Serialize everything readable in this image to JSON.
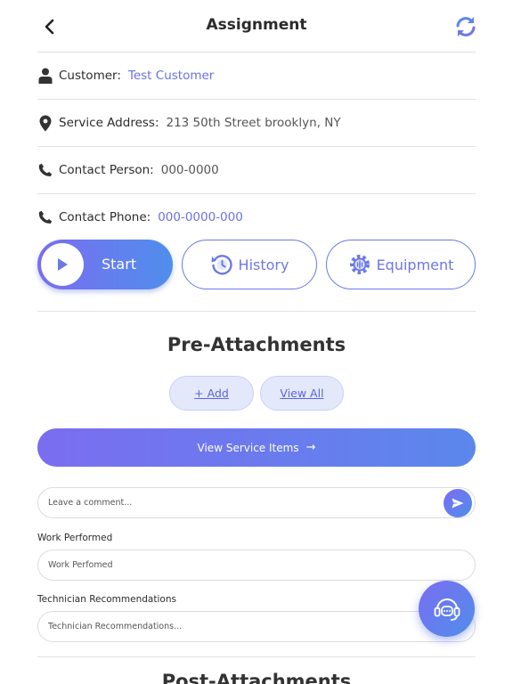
{
  "header": {
    "title": "Assignment",
    "back_icon": "chevron-left-icon",
    "refresh_icon": "refresh-icon"
  },
  "info": {
    "customer": {
      "label": "Customer:",
      "value": "Test Customer",
      "icon": "user-icon"
    },
    "address": {
      "label": "Service Address:",
      "value": "213 50th Street brooklyn, NY",
      "icon": "location-pin-icon"
    },
    "contact_person": {
      "label": "Contact Person:",
      "value": "000-0000",
      "icon": "phone-icon"
    },
    "contact_phone": {
      "label": "Contact Phone:",
      "value": "000-0000-000",
      "icon": "phone-icon"
    }
  },
  "actions": {
    "start": "Start",
    "history": "History",
    "equipment": "Equipment"
  },
  "pre_attachments": {
    "title": "Pre-Attachments",
    "add": "+ Add",
    "view_all": "View All"
  },
  "service_items": {
    "label": "View Service Items",
    "arrow": "→"
  },
  "comment": {
    "placeholder": "Leave a comment..."
  },
  "work_performed": {
    "label": "Work Performed",
    "placeholder": "Work Perfomed"
  },
  "recommendations": {
    "label": "Technician Recommendations",
    "placeholder": "Technician Recommendations..."
  },
  "post_attachments": {
    "title": "Post-Attachments"
  },
  "colors": {
    "accent": "#6d78e6",
    "gradient_start": "#7b6df0",
    "gradient_end": "#4f8eec",
    "link": "#6a73e0"
  }
}
